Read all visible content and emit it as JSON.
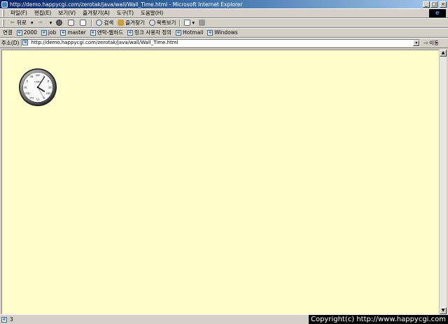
{
  "window": {
    "title": "http://demo.happycgi.com/zerotak/java/wall/Wall_Time.html - Microsoft Internet Explorer",
    "minimize_glyph": "_",
    "maximize_glyph": "□",
    "close_glyph": "×"
  },
  "menubar": {
    "items": [
      "파일(F)",
      "편집(E)",
      "보기(V)",
      "즐겨찾기(A)",
      "도구(T)",
      "도움말(H)"
    ]
  },
  "toolbar": {
    "back_label": "뒤로",
    "back_arrow": "⇦",
    "dropdown_glyph": "▾",
    "forward_arrow": "⇨",
    "search_label": "검색",
    "favorites_label": "즐겨찾기",
    "history_label": "목록보기"
  },
  "linksbar": {
    "label": "연결",
    "links": [
      "2000",
      "job",
      "master",
      "엔탁-웹하드",
      "링크 사용자 정의",
      "Hotmail",
      "Windows"
    ]
  },
  "addressbar": {
    "label": "주소(D)",
    "url": "http://demo.happycgi.com/zerotak/java/wall/Wall_Time.html",
    "go_label": "이동",
    "go_arrow": "⇨",
    "dropdown_glyph": "▾"
  },
  "page": {
    "background": "#ffffcc",
    "clock": {
      "brand": "CRNC",
      "hour": 4,
      "minute": 5,
      "second": 25,
      "numerals": [
        "XII",
        "I",
        "II",
        "III",
        "IIII",
        "V",
        "VI",
        "VII",
        "VIII",
        "IX",
        "X",
        "XI"
      ]
    }
  },
  "scrollbar": {
    "up_glyph": "▲",
    "down_glyph": "▼"
  },
  "statusbar": {
    "text": "3",
    "copyright": "Copyright(c) http://www.happycgi.com"
  },
  "colors": {
    "titlebar_start": "#0a246a",
    "titlebar_end": "#a6caf0",
    "chrome": "#d4d0c8"
  }
}
